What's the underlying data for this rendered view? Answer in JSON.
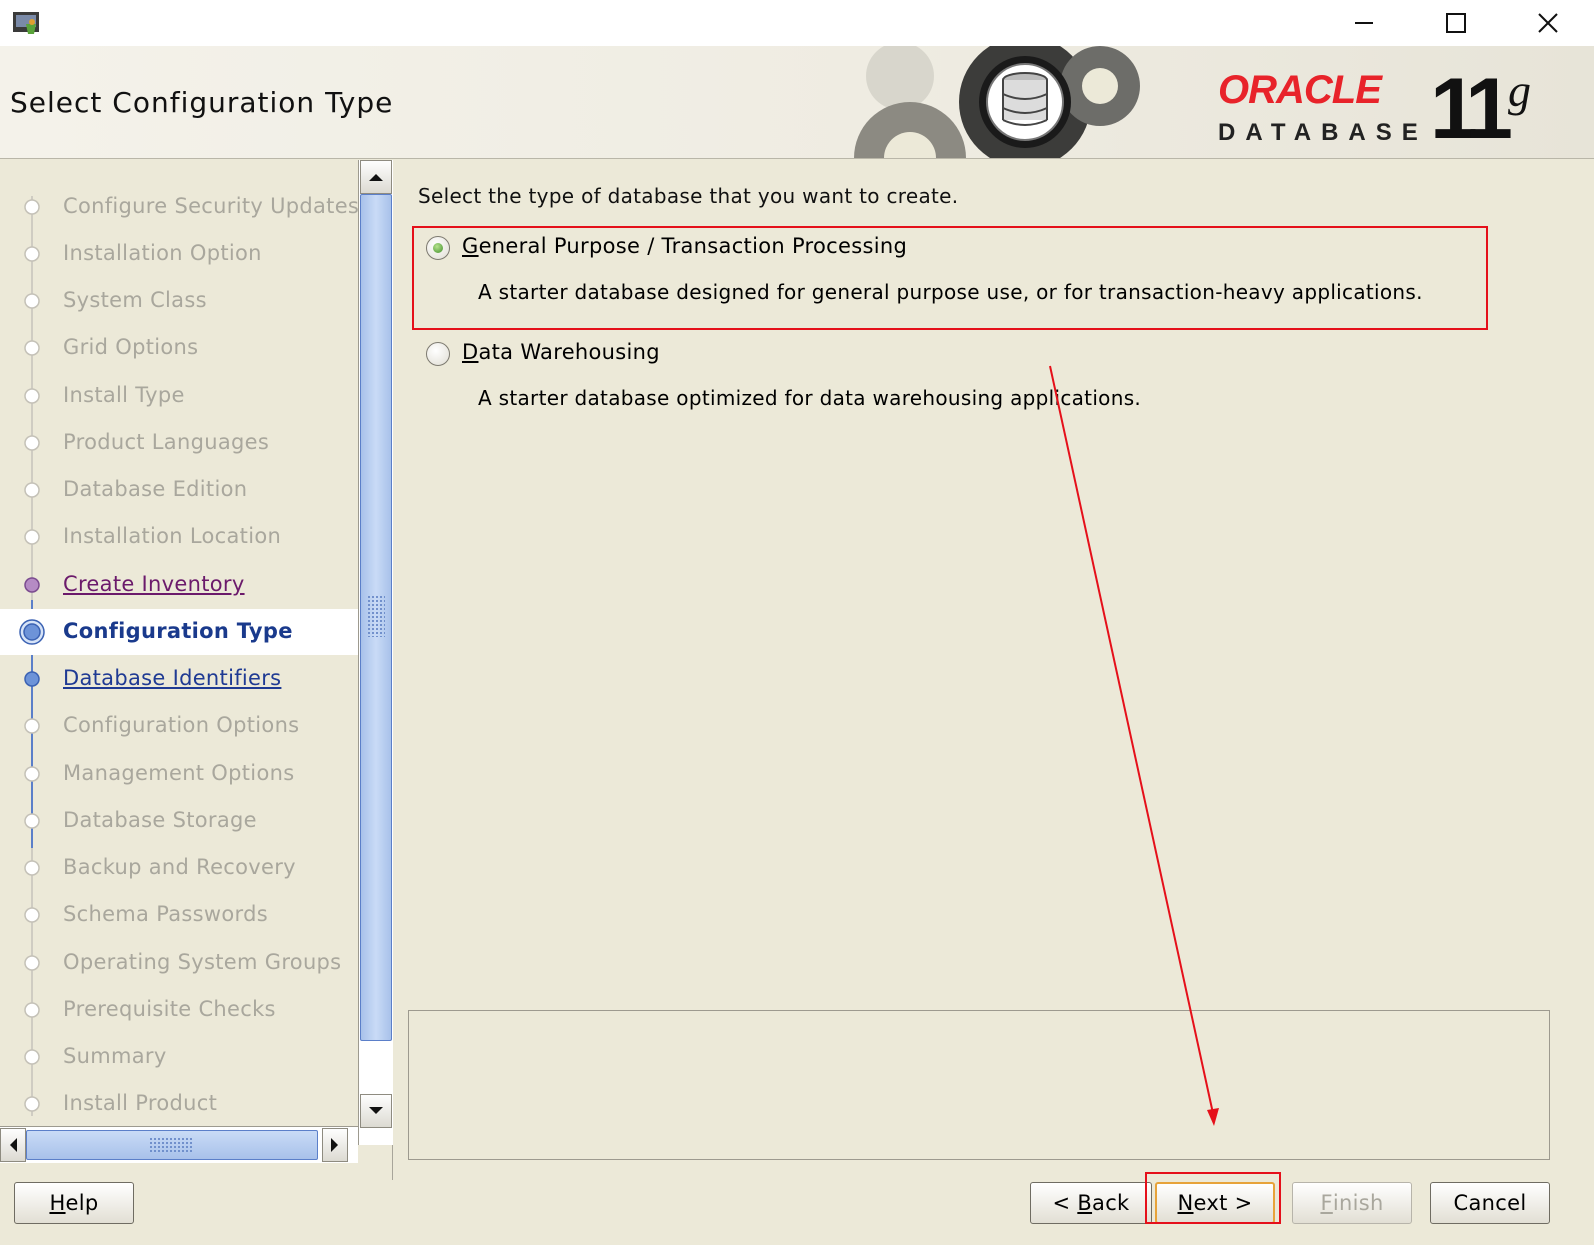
{
  "header": {
    "title": "Select Configuration Type"
  },
  "brand": {
    "oracle": "ORACLE",
    "database": "DATABASE",
    "version": "11",
    "version_suffix": "g",
    "accent": "#e8232a"
  },
  "steps": [
    {
      "label": "Configure Security Updates",
      "state": "pending"
    },
    {
      "label": "Installation Option",
      "state": "pending"
    },
    {
      "label": "System Class",
      "state": "pending"
    },
    {
      "label": "Grid Options",
      "state": "pending"
    },
    {
      "label": "Install Type",
      "state": "pending"
    },
    {
      "label": "Product Languages",
      "state": "pending"
    },
    {
      "label": "Database Edition",
      "state": "pending"
    },
    {
      "label": "Installation Location",
      "state": "pending"
    },
    {
      "label": "Create Inventory",
      "state": "visited"
    },
    {
      "label": "Configuration Type",
      "state": "current"
    },
    {
      "label": "Database Identifiers",
      "state": "next"
    },
    {
      "label": "Configuration Options",
      "state": "pending"
    },
    {
      "label": "Management Options",
      "state": "pending"
    },
    {
      "label": "Database Storage",
      "state": "pending"
    },
    {
      "label": "Backup and Recovery",
      "state": "pending"
    },
    {
      "label": "Schema Passwords",
      "state": "pending"
    },
    {
      "label": "Operating System Groups",
      "state": "pending"
    },
    {
      "label": "Prerequisite Checks",
      "state": "pending"
    },
    {
      "label": "Summary",
      "state": "pending"
    },
    {
      "label": "Install Product",
      "state": "pending"
    }
  ],
  "content": {
    "prompt": "Select the type of database that you want to create.",
    "options": [
      {
        "mnemonic": "G",
        "rest": "eneral Purpose / Transaction Processing",
        "description": "A starter database designed for general purpose use, or for transaction-heavy applications.",
        "selected": true
      },
      {
        "mnemonic": "D",
        "rest": "ata Warehousing",
        "description": "A starter database optimized for data warehousing applications.",
        "selected": false
      }
    ]
  },
  "buttons": {
    "help": {
      "mnemonic": "H",
      "rest": "elp"
    },
    "back": {
      "pre": "< ",
      "mnemonic": "B",
      "rest": "ack"
    },
    "next": {
      "mnemonic": "N",
      "rest": "ext >"
    },
    "finish": {
      "mnemonic": "F",
      "rest": "inish"
    },
    "cancel": {
      "label": "Cancel"
    }
  },
  "annotation_color": "#e5101a"
}
